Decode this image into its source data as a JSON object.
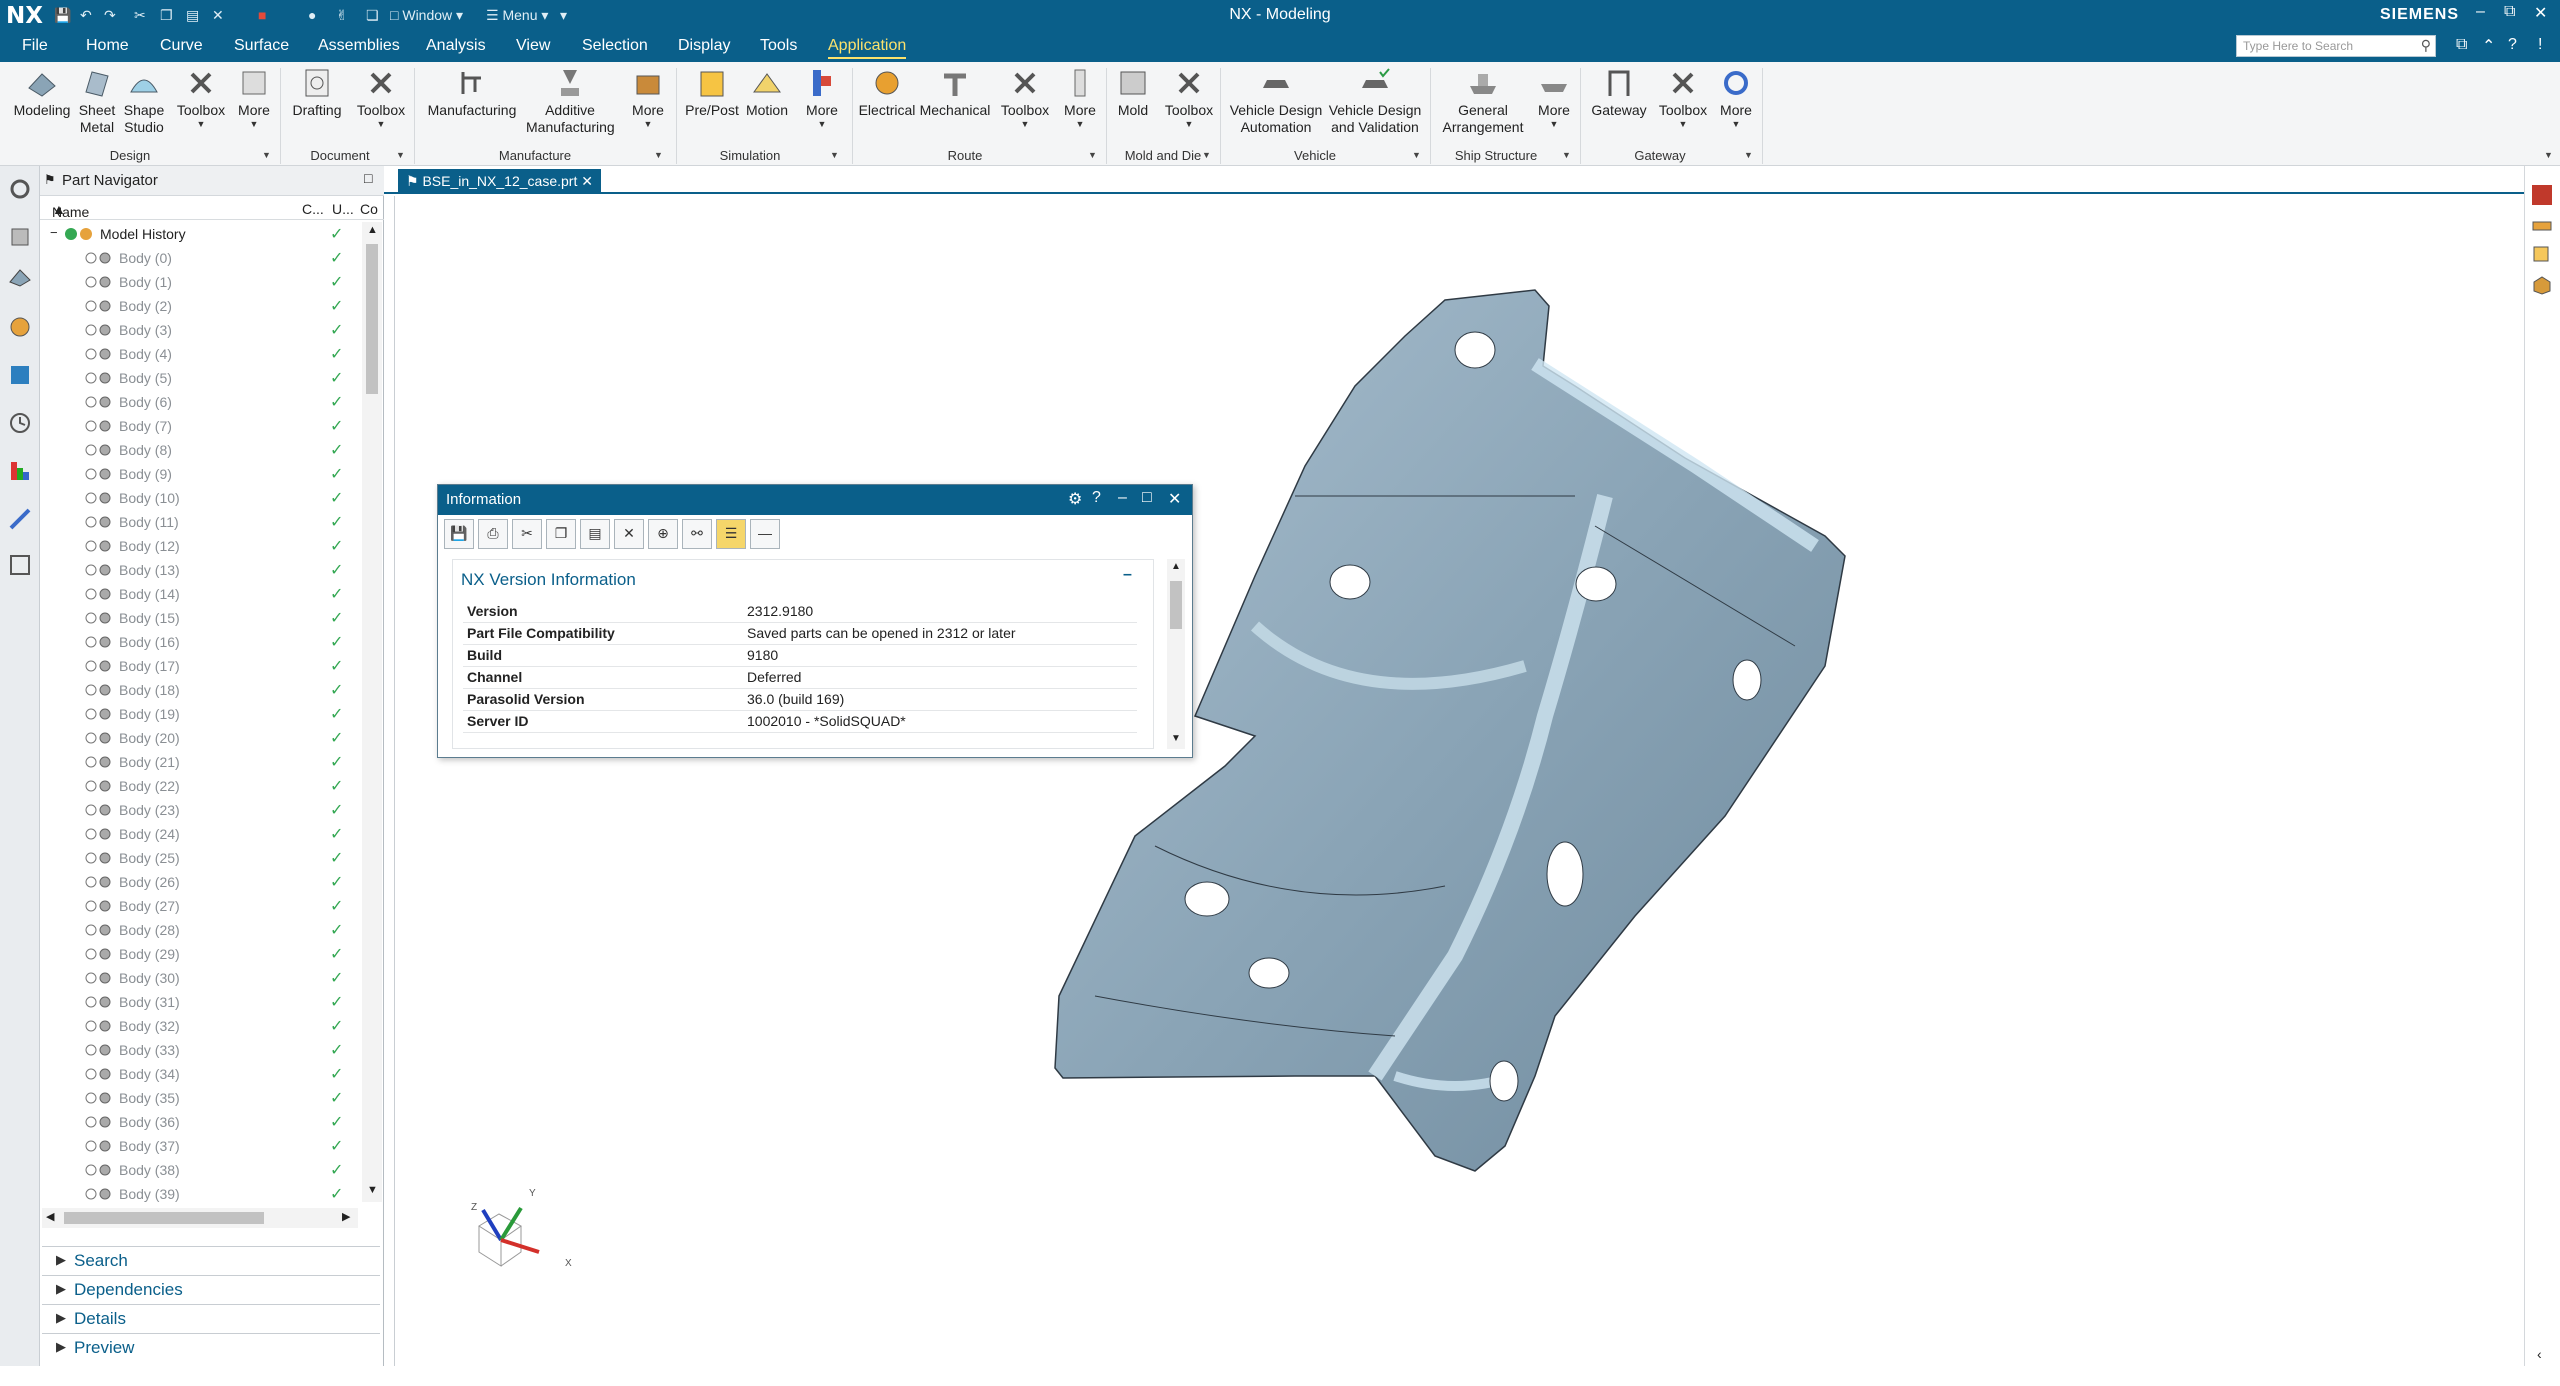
{
  "app": {
    "logo": "NX",
    "title": "NX - Modeling",
    "brand": "SIEMENS",
    "quick_access": {
      "window_label": "Window",
      "menu_label": "Menu"
    }
  },
  "menubar": {
    "items": [
      "File",
      "Home",
      "Curve",
      "Surface",
      "Assemblies",
      "Analysis",
      "View",
      "Selection",
      "Display",
      "Tools",
      "Application"
    ],
    "active": "Application",
    "search_placeholder": "Type Here to Search"
  },
  "ribbon": {
    "groups": [
      {
        "name": "Design",
        "buttons": [
          "Modeling",
          "Sheet Metal",
          "Shape Studio",
          "Toolbox",
          "More"
        ]
      },
      {
        "name": "Document",
        "buttons": [
          "Drafting",
          "Toolbox"
        ]
      },
      {
        "name": "Manufacture",
        "buttons": [
          "Manufacturing",
          "Additive Manufacturing",
          "More"
        ]
      },
      {
        "name": "Simulation",
        "buttons": [
          "Pre/Post",
          "Motion",
          "More"
        ]
      },
      {
        "name": "Route",
        "buttons": [
          "Electrical",
          "Mechanical",
          "Toolbox",
          "More"
        ]
      },
      {
        "name": "Mold and Die",
        "buttons": [
          "Mold",
          "Toolbox"
        ]
      },
      {
        "name": "Vehicle",
        "buttons": [
          "Vehicle Design Automation",
          "Vehicle Design and Validation"
        ]
      },
      {
        "name": "Ship Structure",
        "buttons": [
          "General Arrangement",
          "More"
        ]
      },
      {
        "name": "Gateway",
        "buttons": [
          "Gateway",
          "Toolbox",
          "More"
        ]
      }
    ]
  },
  "part_navigator": {
    "title": "Part Navigator",
    "columns": {
      "name": "Name",
      "c1": "C...",
      "c2": "U...",
      "c3": "Co"
    },
    "root": "Model History",
    "bodies": [
      "Body (0)",
      "Body (1)",
      "Body (2)",
      "Body (3)",
      "Body (4)",
      "Body (5)",
      "Body (6)",
      "Body (7)",
      "Body (8)",
      "Body (9)",
      "Body (10)",
      "Body (11)",
      "Body (12)",
      "Body (13)",
      "Body (14)",
      "Body (15)",
      "Body (16)",
      "Body (17)",
      "Body (18)",
      "Body (19)",
      "Body (20)",
      "Body (21)",
      "Body (22)",
      "Body (23)",
      "Body (24)",
      "Body (25)",
      "Body (26)",
      "Body (27)",
      "Body (28)",
      "Body (29)",
      "Body (30)",
      "Body (31)",
      "Body (32)",
      "Body (33)",
      "Body (34)",
      "Body (35)",
      "Body (36)",
      "Body (37)",
      "Body (38)",
      "Body (39)"
    ],
    "panels": [
      "Search",
      "Dependencies",
      "Details",
      "Preview"
    ]
  },
  "document_tab": {
    "label": "BSE_in_NX_12_case.prt"
  },
  "info_dialog": {
    "title": "Information",
    "section": "NX Version Information",
    "rows": [
      {
        "key": "Version",
        "value": "2312.9180"
      },
      {
        "key": "Part File Compatibility",
        "value": "Saved parts can be opened in 2312 or later"
      },
      {
        "key": "Build",
        "value": "9180"
      },
      {
        "key": "Channel",
        "value": "Deferred"
      },
      {
        "key": "Parasolid Version",
        "value": "36.0 (build 169)"
      },
      {
        "key": "Server ID",
        "value": "1002010 - *SolidSQUAD*"
      }
    ]
  },
  "triad": {
    "x": "X",
    "y": "Y",
    "z": "Z"
  },
  "colors": {
    "title_bar": "#0a5f8a",
    "accent": "#fce26d",
    "part": "#8aa4b6",
    "check": "#34a853"
  }
}
